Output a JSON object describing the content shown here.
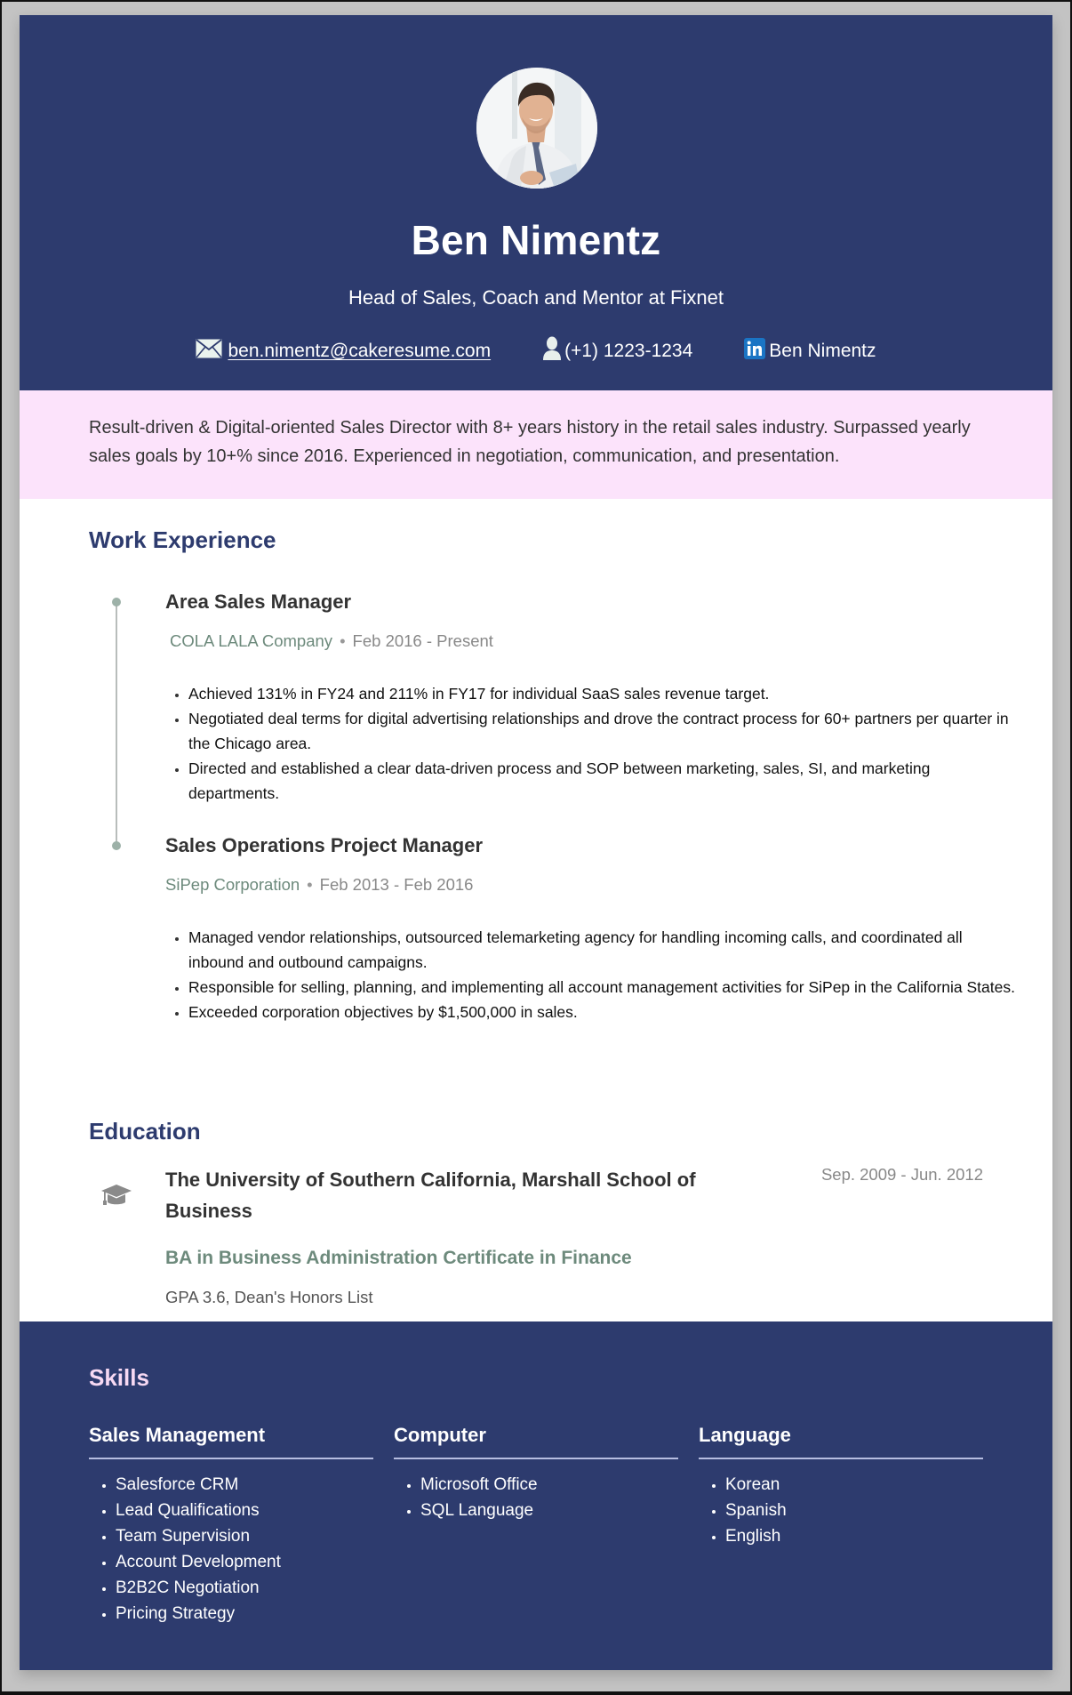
{
  "header": {
    "name": "Ben Nimentz",
    "subtitle": "Head of Sales, Coach and Mentor at Fixnet",
    "contacts": {
      "email": "ben.nimentz@cakeresume.com",
      "phone": "(+1) 1223-1234",
      "linkedin": "Ben Nimentz"
    },
    "icons": {
      "email": "envelope-icon",
      "phone": "person-icon",
      "linkedin": "linkedin-icon"
    }
  },
  "summary": "Result-driven & Digital-oriented Sales Director with 8+ years history in the retail sales industry. Surpassed yearly sales goals by 10+% since 2016. Experienced in negotiation, communication, and presentation.",
  "work": {
    "title": "Work Experience",
    "jobs": [
      {
        "title": "Area Sales Manager",
        "company": "COLA LALA Company",
        "separator": "•",
        "dates": "Feb 2016 - Present",
        "bullets": [
          "Achieved 131% in FY24 and 211% in FY17 for individual SaaS sales revenue target.",
          "Negotiated deal terms for digital advertising relationships and drove the contract process for 60+ partners per quarter in the Chicago area.",
          "Directed and established a clear data-driven process and SOP between marketing, sales, SI, and marketing departments."
        ]
      },
      {
        "title": "Sales Operations Project Manager",
        "company": "SiPep Corporation",
        "separator": "•",
        "dates": "Feb 2013 - Feb 2016",
        "bullets": [
          "Managed vendor relationships, outsourced telemarketing agency for handling incoming calls, and coordinated all inbound and outbound campaigns.",
          "Responsible for selling, planning, and implementing all account management activities for SiPep in the California States.",
          "Exceeded corporation objectives by $1,500,000 in sales."
        ]
      }
    ]
  },
  "education": {
    "title": "Education",
    "icon": "graduation-cap-icon",
    "school": "The University of Southern California, Marshall School of Business",
    "dates": "Sep. 2009 - Jun. 2012",
    "degree": "BA in Business Administration Certificate in Finance",
    "details": "GPA 3.6, Dean's Honors List"
  },
  "skills": {
    "title": "Skills",
    "columns": [
      {
        "heading": "Sales Management",
        "items": [
          "Salesforce CRM",
          "Lead Qualifications",
          "Team Supervision",
          "Account Development",
          "B2B2C Negotiation",
          "Pricing Strategy"
        ]
      },
      {
        "heading": "Computer",
        "items": [
          "Microsoft Office",
          "SQL Language"
        ]
      },
      {
        "heading": "Language",
        "items": [
          "Korean",
          "Spanish",
          "English"
        ]
      }
    ]
  },
  "colors": {
    "navy": "#2d3b6e",
    "summary_bg": "#fce3fb",
    "accent_green": "#6d8a7c",
    "skills_title": "#f7d9f3"
  }
}
